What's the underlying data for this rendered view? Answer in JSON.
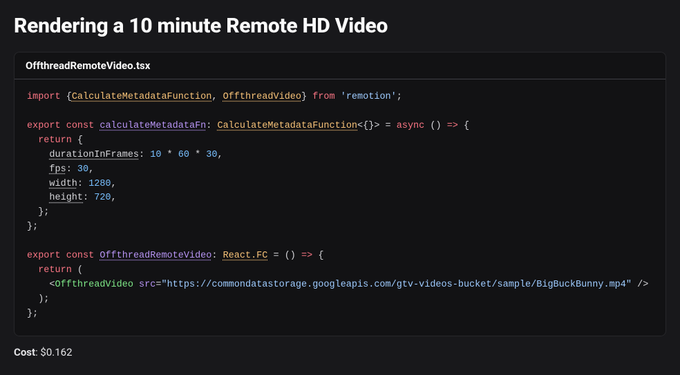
{
  "title": "Rendering a 10 minute Remote HD Video",
  "code": {
    "filename": "OffthreadRemoteVideo.tsx",
    "imports": {
      "sym1": "CalculateMetadataFunction",
      "sym2": "OffthreadVideo",
      "from_kw": "from",
      "import_kw": "import",
      "module": "'remotion'"
    },
    "fn1": {
      "export_kw": "export",
      "const_kw": "const",
      "name": "calculateMetadataFn",
      "type": "CalculateMetadataFunction",
      "generic": "<{}>",
      "async_kw": "async",
      "return_kw": "return",
      "props": {
        "durationInFrames_key": "durationInFrames",
        "durationInFrames_v1": "10",
        "durationInFrames_v2": "60",
        "durationInFrames_v3": "30",
        "fps_key": "fps",
        "fps_val": "30",
        "width_key": "width",
        "width_val": "1280",
        "height_key": "height",
        "height_val": "720"
      }
    },
    "fn2": {
      "export_kw": "export",
      "const_kw": "const",
      "name": "OffthreadRemoteVideo",
      "type": "React.FC",
      "return_kw": "return",
      "jsx_tag": "OffthreadVideo",
      "jsx_attr": "src",
      "jsx_val": "\"https://commondatastorage.googleapis.com/gtv-videos-bucket/sample/BigBuckBunny.mp4\""
    }
  },
  "cost": {
    "label": "Cost",
    "value": "$0.162"
  }
}
